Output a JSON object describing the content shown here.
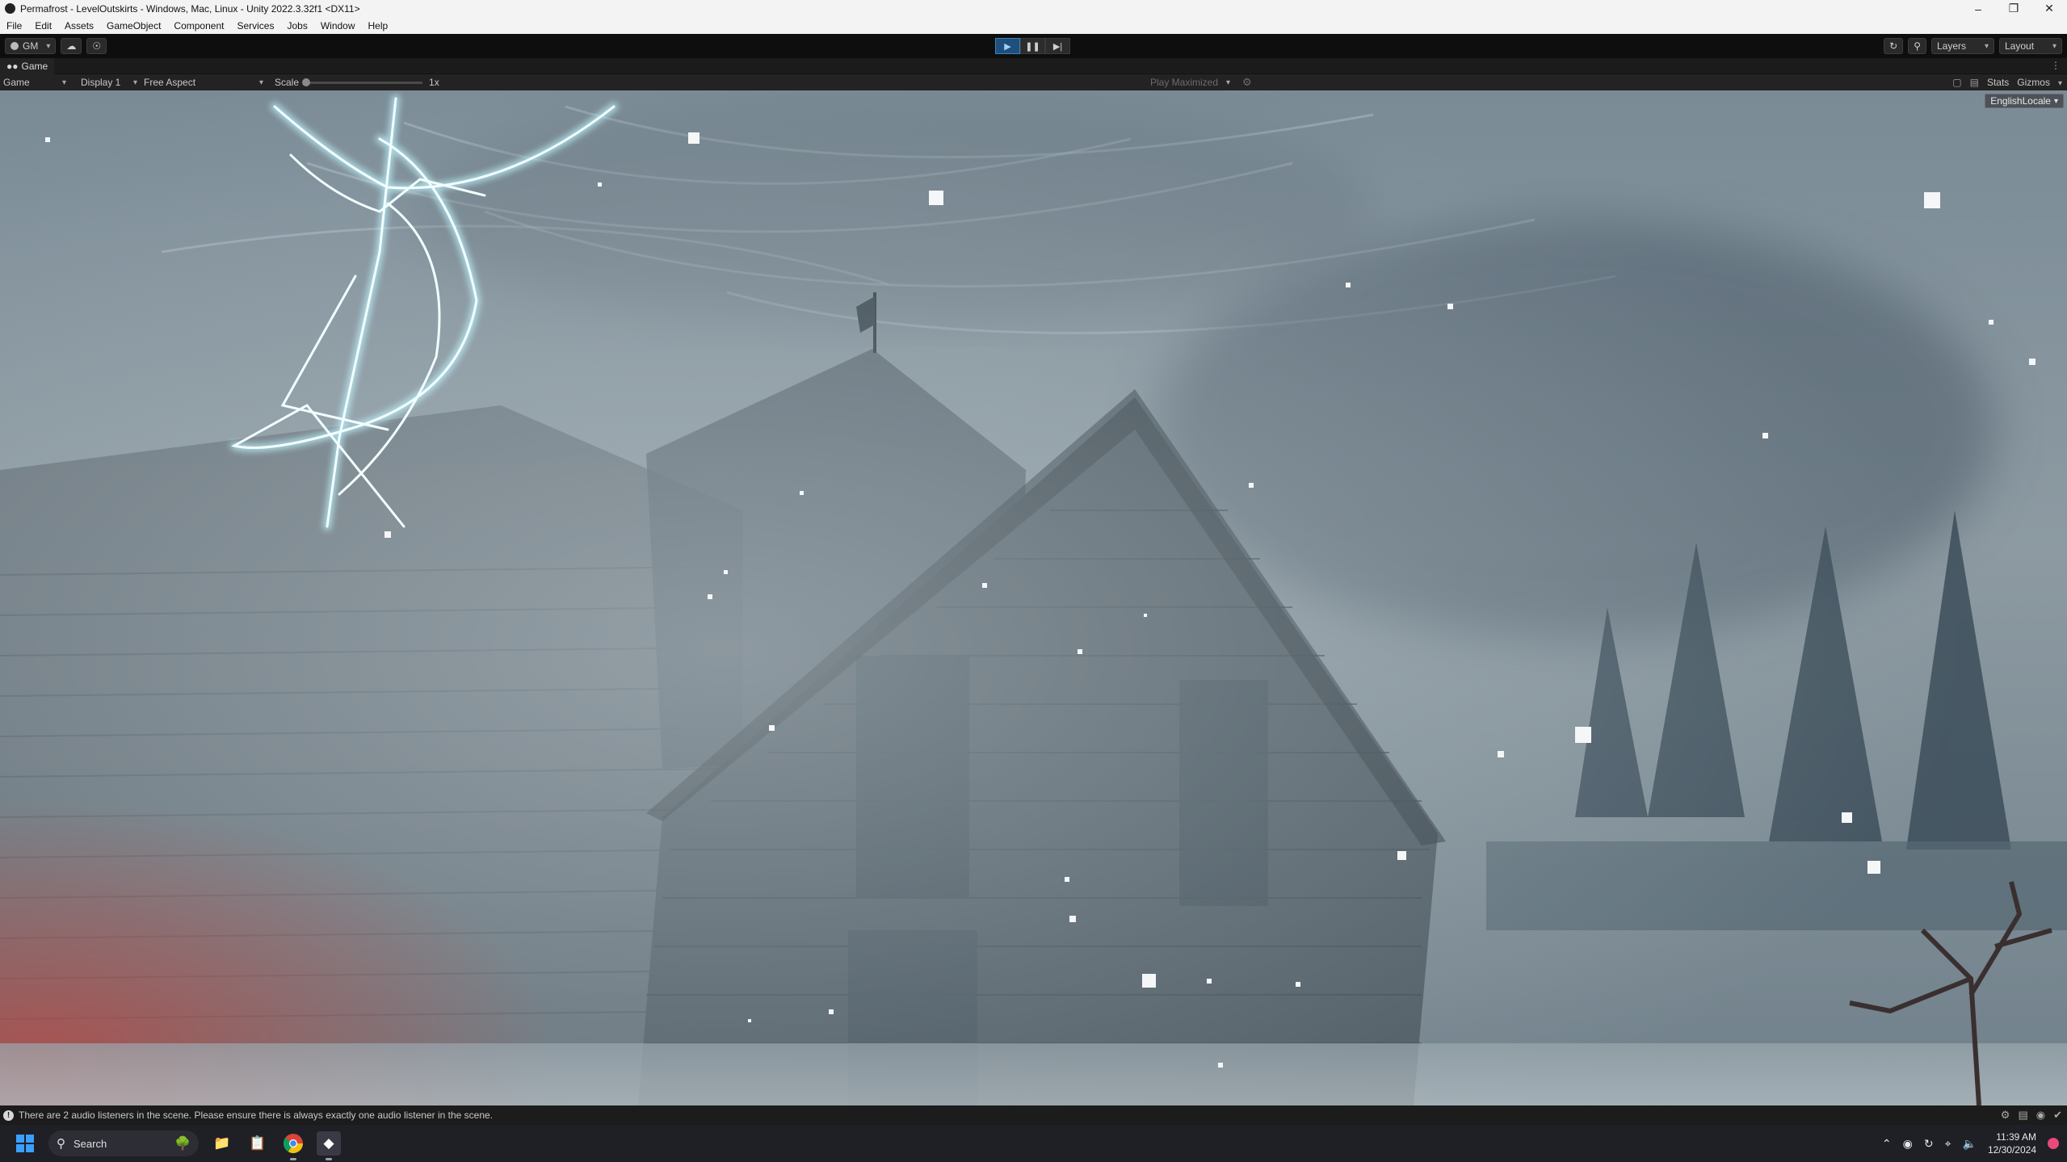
{
  "window": {
    "title": "Permafrost - LevelOutskirts - Windows, Mac, Linux - Unity 2022.3.32f1 <DX11>",
    "controls": [
      "minimize-icon",
      "restore-icon",
      "close-icon"
    ]
  },
  "menu": [
    "File",
    "Edit",
    "Assets",
    "GameObject",
    "Component",
    "Services",
    "Jobs",
    "Window",
    "Help"
  ],
  "toolbar": {
    "account_label": "GM",
    "layers_label": "Layers",
    "layout_label": "Layout",
    "play_state": "playing"
  },
  "game_tab": {
    "label": "Game"
  },
  "game_view": {
    "view_label": "Game",
    "display_label": "Display 1",
    "aspect_label": "Free Aspect",
    "scale_label": "Scale",
    "scale_value": "1x",
    "play_maximized_label": "Play Maximized",
    "stats_label": "Stats",
    "gizmos_label": "Gizmos",
    "locale_label": "EnglishLocale"
  },
  "status": {
    "message": "There are 2 audio listeners in the scene. Please ensure there is always exactly one audio listener in the scene."
  },
  "taskbar": {
    "search_placeholder": "Search",
    "apps": [
      "file-explorer-icon",
      "notepad-icon",
      "chrome-icon",
      "unity-icon"
    ],
    "time": "11:39 AM",
    "date": "12/30/2024"
  },
  "colors": {
    "accent": "#3b82c4",
    "fog": "#8e9ea8",
    "house": "#4f5b63",
    "lightning": "#d8fbff"
  }
}
